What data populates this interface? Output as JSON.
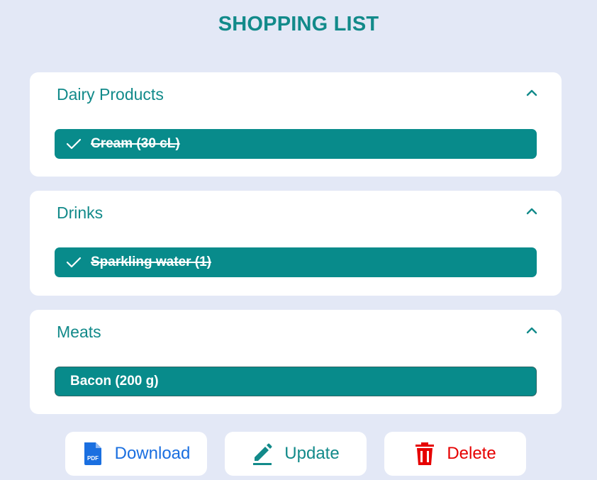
{
  "page": {
    "title": "SHOPPING LIST"
  },
  "categories": [
    {
      "name": "Dairy Products",
      "items": [
        {
          "label": "Cream (30 cL)",
          "checked": true
        }
      ]
    },
    {
      "name": "Drinks",
      "items": [
        {
          "label": "Sparkling water (1)",
          "checked": true
        }
      ]
    },
    {
      "name": "Meats",
      "items": [
        {
          "label": "Bacon (200 g)",
          "checked": false
        }
      ]
    }
  ],
  "actions": {
    "download_label": "Download",
    "download_icon": "pdf-file-icon",
    "pdf_badge": "PDF",
    "update_label": "Update",
    "update_icon": "pencil-icon",
    "delete_label": "Delete",
    "delete_icon": "trash-icon"
  },
  "colors": {
    "background": "#e3e8f6",
    "accent": "#128a8a",
    "item_fill": "#088b8b",
    "download": "#1a6fe0",
    "delete": "#e60000"
  }
}
